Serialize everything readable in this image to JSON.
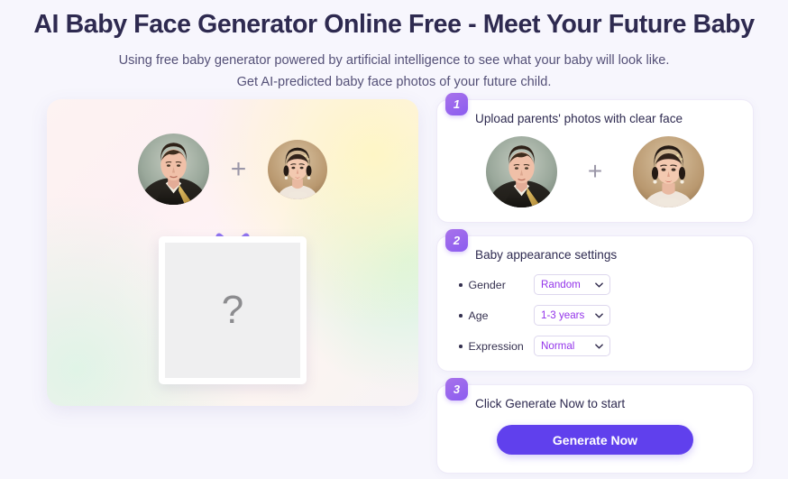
{
  "header": {
    "title": "AI Baby Face Generator Online Free - Meet Your Future Baby",
    "subtitle_line1": "Using free baby generator powered by artificial intelligence to see what your baby will look like.",
    "subtitle_line2": "Get AI-predicted baby face photos of your future child."
  },
  "preview": {
    "father_alt": "father-portrait",
    "mother_alt": "mother-portrait",
    "plus": "+",
    "result_placeholder": "?"
  },
  "steps": [
    {
      "number": "1",
      "heading": "Upload parents' photos with clear face",
      "father_alt": "father-portrait",
      "mother_alt": "mother-portrait",
      "plus": "+"
    },
    {
      "number": "2",
      "heading": "Baby appearance settings",
      "settings": [
        {
          "label": "Gender",
          "value": "Random"
        },
        {
          "label": "Age",
          "value": "1-3 years"
        },
        {
          "label": "Expression",
          "value": "Normal"
        }
      ]
    },
    {
      "number": "3",
      "heading": "Click Generate Now to start",
      "button_label": "Generate Now"
    }
  ],
  "colors": {
    "page_background": "#f7f6fd",
    "heading": "#2e2a50",
    "subtitle": "#545077",
    "badge_purple": "#8b5cf0",
    "select_text": "#9333ea",
    "generate_button": "#6040ed"
  }
}
